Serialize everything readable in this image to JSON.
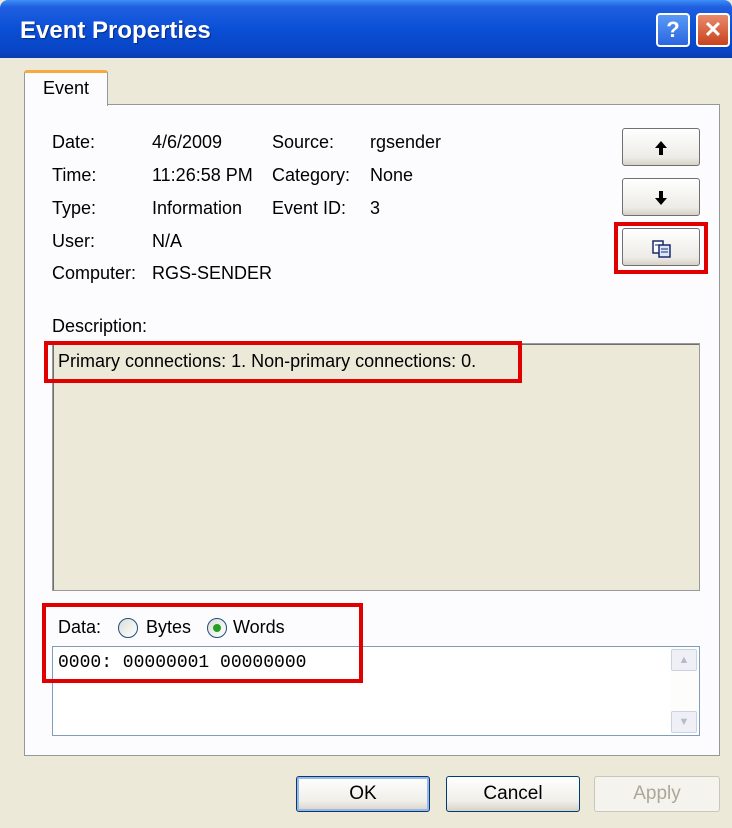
{
  "window": {
    "title": "Event Properties",
    "help_glyph": "?",
    "close_glyph": "✕"
  },
  "tab": {
    "label": "Event"
  },
  "fields": {
    "date_label": "Date:",
    "date_value": "4/6/2009",
    "source_label": "Source:",
    "source_value": "rgsender",
    "time_label": "Time:",
    "time_value": "11:26:58 PM",
    "category_label": "Category:",
    "category_value": "None",
    "type_label": "Type:",
    "type_value": "Information",
    "eventid_label": "Event ID:",
    "eventid_value": "3",
    "user_label": "User:",
    "user_value": "N/A",
    "computer_label": "Computer:",
    "computer_value": "RGS-SENDER"
  },
  "nav": {
    "up_icon": "arrow-up-icon",
    "down_icon": "arrow-down-icon",
    "copy_icon": "copy-icon"
  },
  "description": {
    "label": "Description:",
    "text": "Primary connections: 1.  Non-primary connections: 0."
  },
  "data": {
    "label": "Data:",
    "options": [
      "Bytes",
      "Words"
    ],
    "selected": "Words",
    "content": "0000: 00000001 00000000"
  },
  "buttons": {
    "ok": "OK",
    "cancel": "Cancel",
    "apply": "Apply"
  },
  "colors": {
    "title_bar": "#0a4fd6",
    "highlight": "#e00000",
    "radio_selected": "#21a121"
  }
}
